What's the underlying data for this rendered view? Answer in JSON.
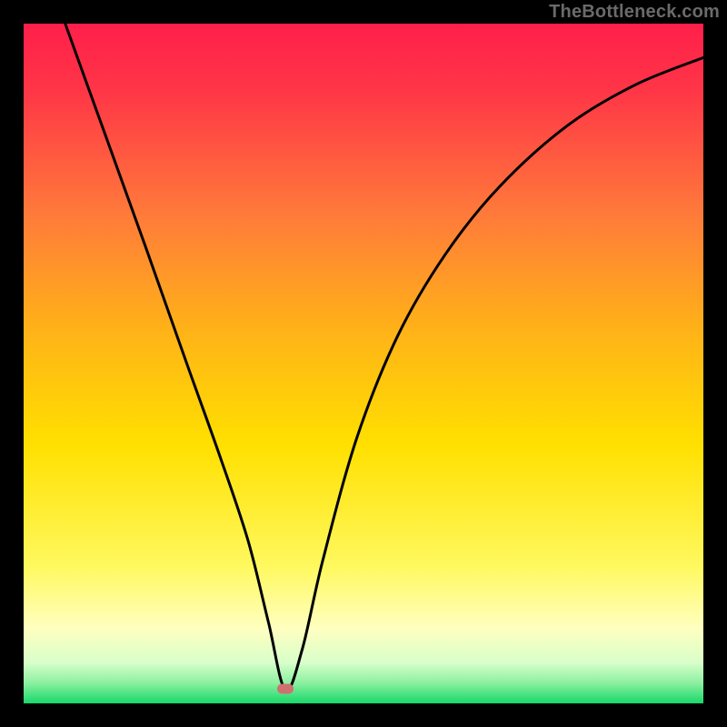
{
  "watermark": "TheBottleneck.com",
  "colors": {
    "frame": "#000000",
    "gradient_top": "#ff1f4a",
    "gradient_mid_upper": "#ffa033",
    "gradient_mid": "#ffe000",
    "gradient_low": "#ffffb0",
    "gradient_bottom": "#17d86a",
    "curve": "#000000",
    "marker": "#cf7170"
  },
  "marker": {
    "x_pct": 38.5,
    "y_pct": 97.9
  },
  "chart_data": {
    "type": "line",
    "title": "",
    "xlabel": "",
    "ylabel": "",
    "xlim": [
      0,
      100
    ],
    "ylim": [
      0,
      100
    ],
    "series": [
      {
        "name": "bottleneck-curve",
        "x": [
          0,
          9,
          18,
          24,
          29,
          33,
          36,
          38.5,
          41,
          44,
          49,
          55,
          62,
          70,
          80,
          90,
          100
        ],
        "y": [
          117,
          92,
          67,
          50,
          36,
          24,
          12,
          2,
          8,
          21,
          39,
          54,
          66,
          76,
          85,
          91,
          95
        ]
      }
    ],
    "marker_point": {
      "x": 38.5,
      "y": 2
    },
    "notes": "Background heat gradient runs red (top / high bottleneck) through orange/yellow to green (bottom / zero bottleneck). Curve minimum marked by small pink/rose pill near x≈38.5%."
  }
}
